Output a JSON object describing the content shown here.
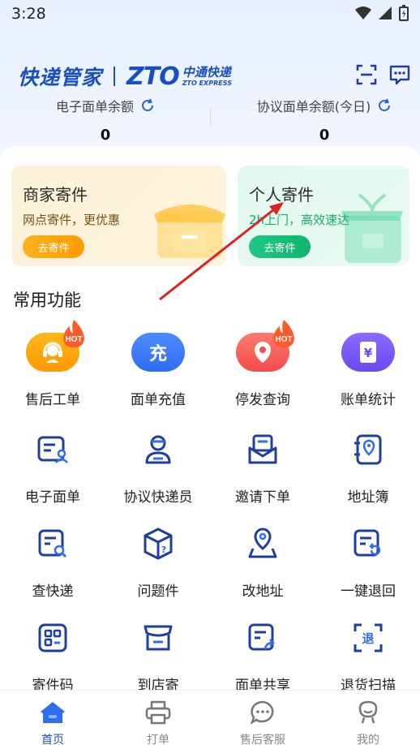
{
  "status_bar": {
    "time": "3:28"
  },
  "brand": {
    "app_name": "快递管家",
    "zto_logo": "ZTO",
    "zto_cn": "中通快递",
    "zto_en": "ZTO EXPRESS"
  },
  "header_icons": [
    "scan-icon",
    "message-icon"
  ],
  "balances": [
    {
      "label": "电子面单余额",
      "value": "0"
    },
    {
      "label": "协议面单余额(今日)",
      "value": "0"
    }
  ],
  "ship_cards": {
    "merchant": {
      "title": "商家寄件",
      "subtitle": "网点寄件，更优惠",
      "button": "去寄件",
      "color": "#ff9a00"
    },
    "personal": {
      "title": "个人寄件",
      "subtitle": "2h上门，高效速达",
      "button": "去寄件",
      "color": "#10b46c"
    }
  },
  "section_title": "常用功能",
  "functions": [
    {
      "label": "售后工单",
      "icon": "headset-icon",
      "hot": true,
      "hot_text": "HOT"
    },
    {
      "label": "面单充值",
      "icon": "recharge-icon",
      "glyph": "充"
    },
    {
      "label": "停发查询",
      "icon": "location-pin-icon",
      "hot": true,
      "hot_text": "HOT"
    },
    {
      "label": "账单统计",
      "icon": "bill-yen-icon",
      "glyph": "¥"
    },
    {
      "label": "电子面单",
      "icon": "e-waybill-icon"
    },
    {
      "label": "协议快递员",
      "icon": "courier-icon"
    },
    {
      "label": "邀请下单",
      "icon": "invite-mail-icon"
    },
    {
      "label": "地址簿",
      "icon": "address-book-icon"
    },
    {
      "label": "查快递",
      "icon": "search-parcel-icon"
    },
    {
      "label": "问题件",
      "icon": "problem-box-icon"
    },
    {
      "label": "改地址",
      "icon": "change-address-icon"
    },
    {
      "label": "一键退回",
      "icon": "return-icon"
    },
    {
      "label": "寄件码",
      "icon": "qr-code-icon"
    },
    {
      "label": "到店寄",
      "icon": "store-icon"
    },
    {
      "label": "面单共享",
      "icon": "share-waybill-icon"
    },
    {
      "label": "退货扫描",
      "icon": "return-scan-icon",
      "glyph": "退"
    }
  ],
  "tabs": [
    {
      "label": "首页",
      "icon": "home-icon",
      "active": true
    },
    {
      "label": "打单",
      "icon": "printer-icon"
    },
    {
      "label": "售后客服",
      "icon": "chat-icon"
    },
    {
      "label": "我的",
      "icon": "profile-icon"
    }
  ],
  "colors": {
    "brand_blue": "#1a4fbf",
    "icon_navy": "#1f3f9e",
    "tab_active": "#1a4fbf"
  }
}
